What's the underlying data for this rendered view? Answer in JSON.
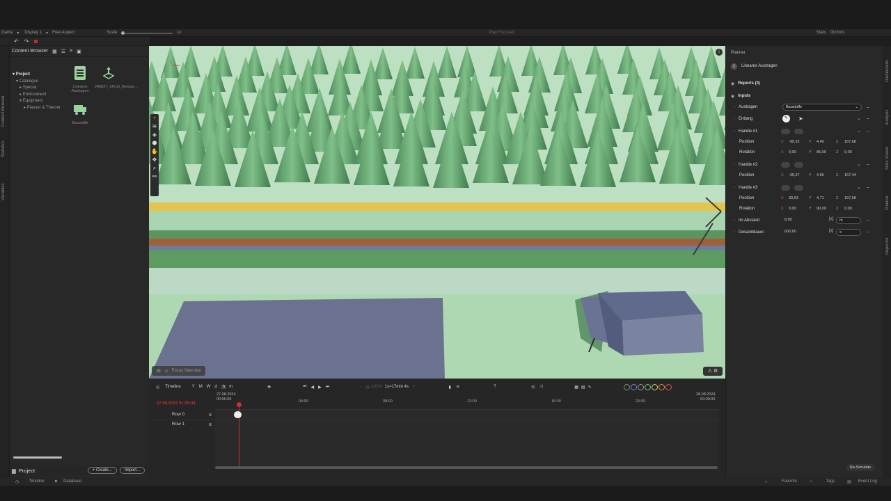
{
  "top_bar": {
    "game": "Game",
    "display": "Display 1",
    "aspect": "Free Aspect",
    "scale_label": "Scale",
    "scale_value": "1x",
    "play_mode": "Play Focused",
    "stats": "Stats",
    "gizmos": "Gizmos"
  },
  "left_vertical_tabs": [
    "Content Browser",
    "Statistics",
    "Variables"
  ],
  "content_browser": {
    "title": "Content Browser",
    "tree": [
      "Project",
      "Catalogue",
      "Special",
      "Environment",
      "Equipment",
      "Plasser & Theurer"
    ],
    "assets": [
      {
        "name": "Lineares Austragen",
        "icon": "document-grid-icon"
      },
      {
        "name": "240827_dPro8_Beispie...",
        "icon": "move-gizmo-icon"
      },
      {
        "name": "Baustoffe",
        "icon": "truck-icon"
      }
    ]
  },
  "project_bar": {
    "label": "Project",
    "create": "+ Create...",
    "import": "Import..."
  },
  "viewport": {
    "focus_selection": "Focus Selection"
  },
  "timeline": {
    "title": "Timeline",
    "units": [
      "Y",
      "M",
      "W",
      "d",
      "h",
      "m"
    ],
    "speed": "1s=17min 4s",
    "speed_hidden": "x1024",
    "start_date": "27.08.2024",
    "start_time": "00:00:00",
    "end_date": "28.08.2024",
    "end_time": "00:00:00",
    "current": "27.08.2024 01:09:44",
    "ticks": [
      "04:00",
      "08:00",
      "12:00",
      "16:00",
      "20:00"
    ],
    "rows": [
      "Row 0",
      "Row 1"
    ]
  },
  "planner": {
    "title": "Planner",
    "item_index": "1",
    "item": "Lineares Austragen",
    "reports": "Reports (0)",
    "inputs": "Inputs",
    "austragen_label": "Austragen",
    "austragen_value": "Baustoffe",
    "entlang_label": "Entlang",
    "handles": [
      {
        "label": "Handle #1",
        "position": {
          "x": "-95,32",
          "y": "4,40",
          "z": "167,68"
        },
        "rotation": {
          "x": "0,00",
          "y": "85,00",
          "z": "0,00"
        }
      },
      {
        "label": "Handle #2",
        "position": {
          "x": "-35,57",
          "y": "4,66",
          "z": "167,44"
        }
      },
      {
        "label": "Handle #3",
        "position": {
          "x": "30,93",
          "y": "4,71",
          "z": "167,58"
        },
        "rotation": {
          "x": "0,00",
          "y": "90,00",
          "z": "0,00"
        }
      }
    ],
    "position_label": "Position",
    "rotation_label": "Rotation",
    "axis": {
      "x": "X",
      "y": "Y",
      "z": "Z"
    },
    "abstand_label": "Im Abstand",
    "abstand_value": "8,00",
    "abstand_unit": "m",
    "dauer_label": "Gesamtdauer",
    "dauer_value": "600,00",
    "dauer_unit": "s",
    "resimulate": "Re-Simulate"
  },
  "right_vertical_tabs": [
    "Dashboards",
    "Analysis",
    "Stats Viewer",
    "Planner",
    "Inspector"
  ],
  "bottom_bar": {
    "timeline": "Timeline",
    "database": "Database",
    "favorite": "Favorite",
    "tags": "Tags",
    "event_log": "Event Log"
  },
  "colors": {
    "accent_red": "#e03030",
    "asset_green": "#9bd49b",
    "tree": "#5a9a66",
    "grass": "#a8d5b0",
    "road_yellow": "#e3c44e"
  }
}
